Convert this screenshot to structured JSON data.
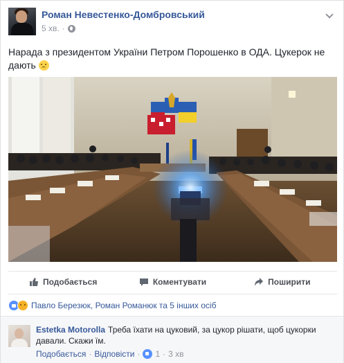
{
  "post": {
    "author": "Роман Невестенко-Домбровський",
    "time": "5 хв.",
    "separator": "·",
    "text": "Нарада з президентом України Петром Порошенко в ОДА. Цукерок не дають"
  },
  "actions": {
    "like": "Подобається",
    "comment": "Коментувати",
    "share": "Поширити"
  },
  "reactions": {
    "summary": "Павло Березюк, Роман Романюк та 5 інших осіб"
  },
  "comment": {
    "author": "Estetka Motorolla",
    "text": "Треба їхати на цуковий, за цукор рішати, щоб цукорки давали. Скажи їм.",
    "like": "Подобається",
    "dot": "·",
    "reply": "Відповісти",
    "like_count": "1",
    "time": "3 хв"
  },
  "colors": {
    "link": "#365899",
    "meta": "#90949c",
    "text": "#1d2129",
    "like_blue": "#5890ff"
  },
  "icons": [
    "globe-icon",
    "chevron-down-icon",
    "like-icon",
    "comment-icon",
    "share-icon",
    "sad-emoji-icon"
  ]
}
